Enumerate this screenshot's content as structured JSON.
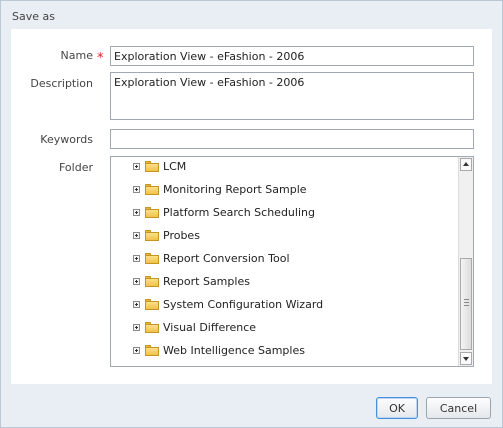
{
  "dialog": {
    "title": "Save as"
  },
  "form": {
    "name_label": "Name",
    "required_marker": "*",
    "name_value": "Exploration View - eFashion - 2006",
    "description_label": "Description",
    "description_value": "Exploration View - eFashion - 2006",
    "keywords_label": "Keywords",
    "keywords_value": "",
    "folder_label": "Folder"
  },
  "folders": [
    {
      "label": "LCM",
      "icon": "folder-icon",
      "expander": "plus-icon"
    },
    {
      "label": "Monitoring Report Sample",
      "icon": "folder-icon",
      "expander": "plus-icon"
    },
    {
      "label": "Platform Search Scheduling",
      "icon": "folder-icon",
      "expander": "plus-icon"
    },
    {
      "label": "Probes",
      "icon": "folder-icon",
      "expander": "plus-icon"
    },
    {
      "label": "Report Conversion Tool",
      "icon": "folder-icon",
      "expander": "plus-icon"
    },
    {
      "label": "Report Samples",
      "icon": "folder-icon",
      "expander": "plus-icon"
    },
    {
      "label": "System Configuration Wizard",
      "icon": "folder-icon",
      "expander": "plus-icon"
    },
    {
      "label": "Visual Difference",
      "icon": "folder-icon",
      "expander": "plus-icon"
    },
    {
      "label": "Web Intelligence Samples",
      "icon": "folder-icon",
      "expander": "plus-icon"
    }
  ],
  "buttons": {
    "ok_label": "OK",
    "cancel_label": "Cancel"
  },
  "colors": {
    "required": "#dd2222",
    "folder": "#f2c24a",
    "ok_focus_border": "#4a90d9"
  }
}
